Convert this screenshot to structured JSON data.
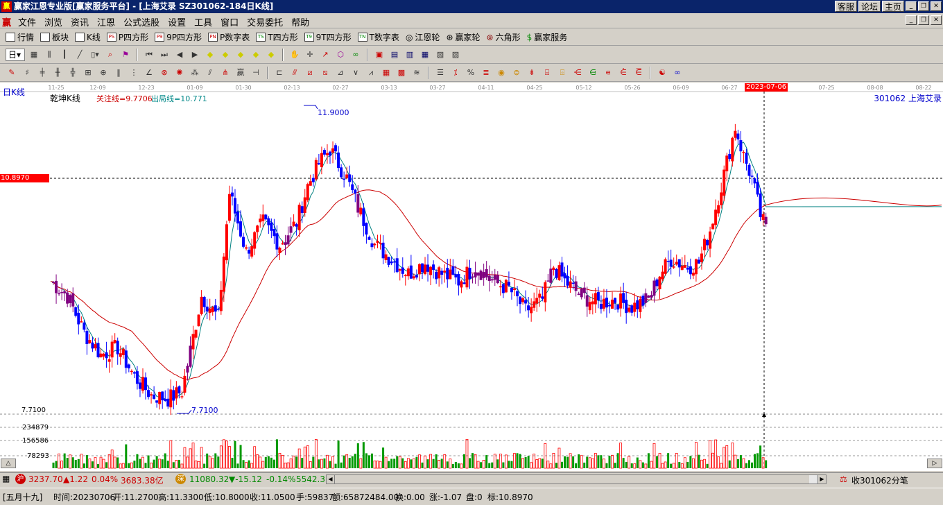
{
  "window": {
    "title": "赢家江恩专业版[赢家服务平台] - [上海艾录   SZ301062-184日K线]",
    "links": [
      "客服",
      "论坛",
      "主页"
    ]
  },
  "menu": [
    "文件",
    "浏览",
    "资讯",
    "江恩",
    "公式选股",
    "设置",
    "工具",
    "窗口",
    "交易委托",
    "帮助"
  ],
  "toolbar1": [
    {
      "icon": "table-icon",
      "label": "行情"
    },
    {
      "icon": "blocks-icon",
      "label": "板块"
    },
    {
      "icon": "candle-icon",
      "label": "K线"
    },
    {
      "icon": "ps-icon",
      "label": "P四方形"
    },
    {
      "icon": "p9-icon",
      "label": "9P四方形"
    },
    {
      "icon": "pn-icon",
      "label": "P数字表"
    },
    {
      "icon": "ts-icon",
      "label": "T四方形"
    },
    {
      "icon": "t9-icon",
      "label": "9T四方形"
    },
    {
      "icon": "tn-icon",
      "label": "T数字表"
    },
    {
      "icon": "wheel-icon",
      "label": "江恩轮"
    },
    {
      "icon": "winner-wheel-icon",
      "label": "赢家轮"
    },
    {
      "icon": "hexagon-icon",
      "label": "六角形"
    },
    {
      "icon": "dollar-icon",
      "label": "赢家服务"
    }
  ],
  "period_select": "日",
  "chart": {
    "period_label": "日K线",
    "indicator_name": "乾坤K线",
    "focus_line_label": "关注线=9.7706",
    "exit_line_label": "出局线=10.771",
    "stock_label": "301062  上海艾录",
    "price_marker": "10.8970",
    "high_label": "11.9000",
    "low_label": "7.7100",
    "low_axis_label": "7.7100",
    "cursor_date": "2023-07-06",
    "date_ticks": [
      "11-25",
      "12-09",
      "12-23",
      "01-09",
      "01-30",
      "02-13",
      "02-27",
      "03-13",
      "03-27",
      "04-11",
      "04-25",
      "05-12",
      "05-26",
      "06-09",
      "06-27",
      "07-25",
      "08-08",
      "08-22"
    ],
    "volume_ticks": [
      "234879",
      "156586",
      "78293"
    ],
    "colors": {
      "up": "#ff0000",
      "down": "#0000ff",
      "neutral": "#800080",
      "ma_short": "#008080",
      "ma_long": "#cc0000",
      "volume_up": "#ff0000",
      "volume_down": "#009900",
      "cursor_tag": "#ff0000"
    }
  },
  "status": {
    "sh_badge": "沪",
    "sh_index": "3237.70",
    "sh_change": "▲1.22",
    "sh_pct": "0.04%",
    "sh_amount": "3683.38亿",
    "sz_badge": "深",
    "sz_index": "11080.32",
    "sz_change": "▼-15.12",
    "sz_pct": "-0.14%",
    "sz_amount": "5542.3",
    "right_text": "收301062分笔"
  },
  "info": {
    "lunar": "[五月十九]",
    "time": "时间:20230706",
    "open": "开:11.2700",
    "high": "高:11.3300",
    "low": "低:10.8000",
    "close": "收:11.0500",
    "hands": "手:59837",
    "amount": "额:65872484.00",
    "turnover": "换:0.00",
    "change": "涨:-1.07",
    "pan": "盘:0",
    "mark": "标:10.8970"
  }
}
